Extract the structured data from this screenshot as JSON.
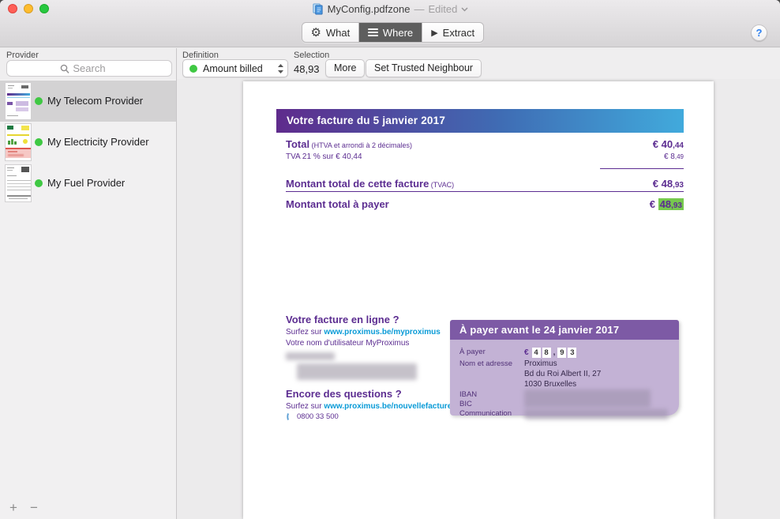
{
  "titlebar": {
    "title": "MyConfig.pdfzone",
    "separator": "—",
    "status": "Edited",
    "help_label": "?"
  },
  "toolbar": {
    "what": "What",
    "where": "Where",
    "extract": "Extract"
  },
  "filterbar": {
    "provider_label": "Provider",
    "search_placeholder": "Search",
    "definition_label": "Definition",
    "definition_value": "Amount billed",
    "selection_label": "Selection",
    "selection_value": "48,93",
    "more_label": "More",
    "trusted_label": "Set Trusted Neighbour"
  },
  "sidebar": {
    "items": [
      {
        "label": "My Telecom Provider",
        "status": "green",
        "selected": true
      },
      {
        "label": "My Electricity Provider",
        "status": "green",
        "selected": false
      },
      {
        "label": "My Fuel Provider",
        "status": "green",
        "selected": false
      }
    ],
    "add_label": "+",
    "remove_label": "−"
  },
  "invoice": {
    "banner_title": "Votre facture du 5 janvier 2017",
    "total_label": "Total",
    "total_note": " (HTVA et arrondi à 2 décimales)",
    "total_amount": "€ 40",
    "total_dec": ",44",
    "tva_label": "TVA 21 % sur € 40,44",
    "tva_amount": "€ 8",
    "tva_dec": ",49",
    "facture_label": "Montant total de cette facture",
    "facture_note": " (TVAC)",
    "facture_amount": "€ 48",
    "facture_dec": ",93",
    "payer_label": "Montant total à payer",
    "payer_cur": "€ ",
    "payer_amount": "48",
    "payer_dec": ",93",
    "online_heading": "Votre facture en ligne ?",
    "online_prefix": "Surfez sur ",
    "online_link": "www.proximus.be/myproximus",
    "online_username": "Votre nom d'utilisateur MyProximus",
    "questions_heading": "Encore des questions ?",
    "questions_prefix": "Surfez sur ",
    "questions_link": "www.proximus.be/nouvellefacture",
    "phone": "0800 33 500",
    "paybox": {
      "header": "À payer avant le 24 janvier 2017",
      "apayer_label": "À payer",
      "cur": "€",
      "digits": [
        "4",
        "8",
        ",",
        "9",
        "3"
      ],
      "nom_label": "Nom et adresse",
      "nom_lines": [
        "Proximus",
        "Bd du Roi Albert II, 27",
        "1030 Bruxelles"
      ],
      "iban_label": "IBAN",
      "bic_label": "BIC",
      "comm_label": "Communication"
    }
  },
  "colors": {
    "proximus_purple": "#5c2d91",
    "banner_gradient_start": "#5f2b8c",
    "banner_gradient_end": "#41aadc",
    "link_blue": "#0a9bd7",
    "selection_highlight_green": "#76c84e",
    "status_dot_green": "#3fc843",
    "paybox_header_purple": "#7d5aa5",
    "paybox_body_purple": "#c3b2d5",
    "selected_segment_gray": "#5e5e5e"
  }
}
